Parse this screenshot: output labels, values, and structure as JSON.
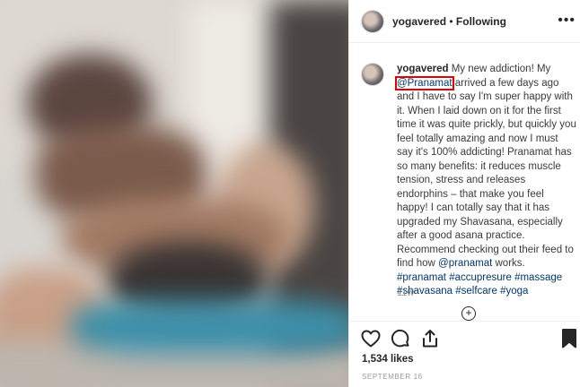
{
  "post": {
    "username": "yogavered",
    "separator": "•",
    "follow_status": "Following",
    "more_icon": "more-horizontal-icon"
  },
  "caption": {
    "username": "yogavered",
    "text_before_mention": " My new addiction! My ",
    "mention": "@Pranamat",
    "text_after_mention": " arrived a few days ago and I have to say I'm super happy with it. When I laid down on it for the first time it was quite prickly, but quickly you feel totally amazing and now I must say it's 100% addicting! Pranamat has so many benefits: it reduces muscle tension, stress and releases endorphins – that make you feel happy! I can totally say that it has upgraded my Shavasana, especially after a good asana practice. Recommend checking out their feed to find how ",
    "mention2": "@pranamat",
    "text_end": " works.",
    "hashtags": [
      "#pranamat",
      "#accupresure",
      "#massage",
      "#shavasana",
      "#selfcare",
      "#yoga"
    ],
    "time_ago": "11w",
    "load_more_symbol": "+"
  },
  "actions": {
    "likes": "1,534 likes",
    "date": "SEPTEMBER 16"
  },
  "colors": {
    "link": "#00376b",
    "highlight": "#e00000",
    "muted": "#999999"
  }
}
